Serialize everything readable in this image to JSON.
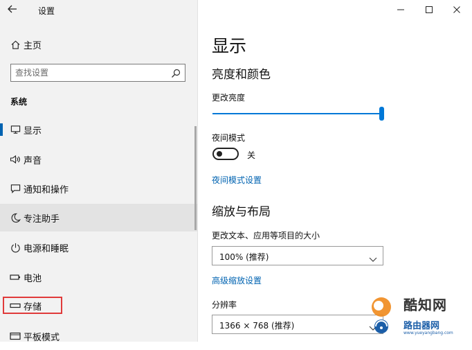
{
  "window": {
    "title": "设置",
    "controls": [
      "minimize-icon",
      "maximize-icon",
      "close-icon"
    ]
  },
  "sidebar": {
    "home_label": "主页",
    "search_placeholder": "查找设置",
    "section_title": "系统",
    "items": [
      {
        "label": "显示",
        "icon": "monitor-icon",
        "active": true
      },
      {
        "label": "声音",
        "icon": "speaker-icon"
      },
      {
        "label": "通知和操作",
        "icon": "notification-icon"
      },
      {
        "label": "专注助手",
        "icon": "moon-icon",
        "hover": true
      },
      {
        "label": "电源和睡眠",
        "icon": "power-icon"
      },
      {
        "label": "电池",
        "icon": "battery-icon"
      },
      {
        "label": "存储",
        "icon": "storage-icon",
        "highlighted": true
      },
      {
        "label": "平板模式",
        "icon": "tablet-icon"
      }
    ]
  },
  "main": {
    "page_title": "显示",
    "brightness_section": "亮度和颜色",
    "brightness_label": "更改亮度",
    "brightness_value": 100,
    "night_light_label": "夜间模式",
    "night_light_state": "关",
    "night_light_on": false,
    "night_light_link": "夜间模式设置",
    "scale_section": "缩放与布局",
    "scale_label": "更改文本、应用等项目的大小",
    "scale_value": "100% (推荐)",
    "advanced_scale_link": "高级缩放设置",
    "resolution_label": "分辨率",
    "resolution_value": "1366 × 768 (推荐)"
  },
  "watermark": {
    "brand": "酷知网",
    "name": "路由器网",
    "url": "www.yueyangbang.com"
  },
  "colors": {
    "accent": "#0078d7",
    "link": "#0063b1",
    "highlight_box": "#e03a3a",
    "sidebar_bg": "#f2f2f2"
  }
}
